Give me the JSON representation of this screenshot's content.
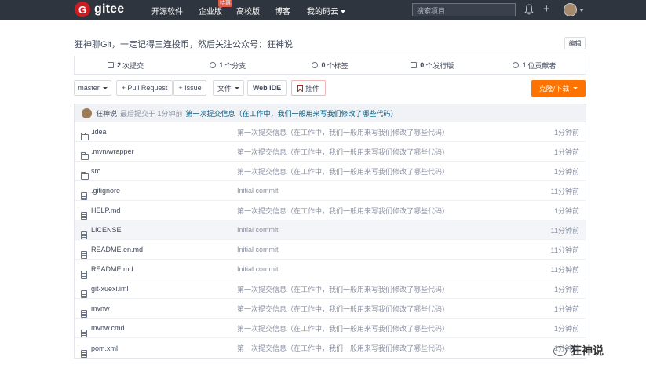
{
  "nav": {
    "logo_letter": "G",
    "logo_text": "gitee",
    "items": [
      {
        "label": "开源软件",
        "has_caret": false
      },
      {
        "label": "企业版",
        "has_caret": false
      },
      {
        "label": "高校版",
        "has_caret": false
      },
      {
        "label": "博客",
        "has_caret": false
      },
      {
        "label": "我的码云",
        "has_caret": true
      }
    ],
    "enterprise_badge": "特惠",
    "search_placeholder": "搜索项目"
  },
  "repo": {
    "description": "狂神聊Git，一定记得三连投币，然后关注公众号：狂神说",
    "edit_label": "编辑",
    "stats": [
      {
        "count": "2",
        "label": "次提交",
        "icon": "commit-icon"
      },
      {
        "count": "1",
        "label": "个分支",
        "icon": "branch-icon"
      },
      {
        "count": "0",
        "label": "个标签",
        "icon": "tag-icon"
      },
      {
        "count": "0",
        "label": "个发行版",
        "icon": "release-icon"
      },
      {
        "count": "1",
        "label": "位贡献者",
        "icon": "contributor-icon"
      }
    ]
  },
  "toolbar": {
    "branch": "master",
    "pull_request": "+ Pull Request",
    "issue": "+ Issue",
    "file": "文件",
    "webide": "Web IDE",
    "bookmark": "挂件",
    "clone": "克隆/下载"
  },
  "commit": {
    "user": "狂神说",
    "meta": "最后提交于 1分钟前",
    "message": "第一次提交信息（在工作中，我们一般用来写我们修改了哪些代码）"
  },
  "files": [
    {
      "name": ".idea",
      "type": "folder",
      "message": "第一次提交信息（在工作中，我们一般用来写我们修改了哪些代码）",
      "time": "1分钟前"
    },
    {
      "name": ".mvn/wrapper",
      "type": "folder",
      "message": "第一次提交信息（在工作中，我们一般用来写我们修改了哪些代码）",
      "time": "1分钟前"
    },
    {
      "name": "src",
      "type": "folder",
      "message": "第一次提交信息（在工作中，我们一般用来写我们修改了哪些代码）",
      "time": "1分钟前"
    },
    {
      "name": ".gitignore",
      "type": "file",
      "message": "Initial commit",
      "time": "11分钟前"
    },
    {
      "name": "HELP.md",
      "type": "file",
      "message": "第一次提交信息（在工作中，我们一般用来写我们修改了哪些代码）",
      "time": "1分钟前"
    },
    {
      "name": "LICENSE",
      "type": "file",
      "message": "Initial commit",
      "time": "11分钟前"
    },
    {
      "name": "README.en.md",
      "type": "file",
      "message": "Initial commit",
      "time": "11分钟前"
    },
    {
      "name": "README.md",
      "type": "file",
      "message": "Initial commit",
      "time": "11分钟前"
    },
    {
      "name": "git-xuexi.iml",
      "type": "file",
      "message": "第一次提交信息（在工作中，我们一般用来写我们修改了哪些代码）",
      "time": "1分钟前"
    },
    {
      "name": "mvnw",
      "type": "file",
      "message": "第一次提交信息（在工作中，我们一般用来写我们修改了哪些代码）",
      "time": "1分钟前"
    },
    {
      "name": "mvnw.cmd",
      "type": "file",
      "message": "第一次提交信息（在工作中，我们一般用来写我们修改了哪些代码）",
      "time": "1分钟前"
    },
    {
      "name": "pom.xml",
      "type": "file",
      "message": "第一次提交信息（在工作中，我们一般用来写我们修改了哪些代码）",
      "time": "1分钟前"
    }
  ],
  "watermark": "狂神说",
  "colors": {
    "nav_bg": "#2f353e",
    "logo": "#c71d23",
    "clone": "#fe7300",
    "link": "#005980"
  }
}
